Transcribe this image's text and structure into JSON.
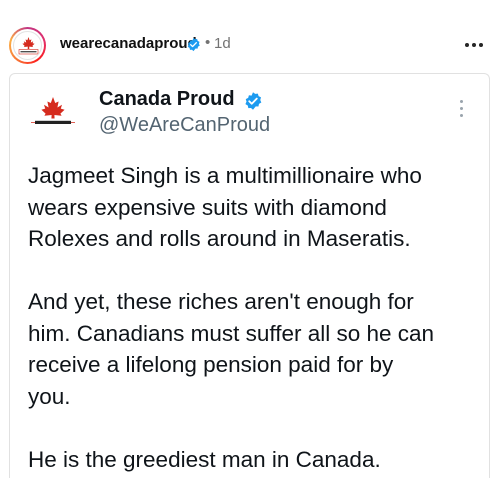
{
  "post": {
    "username": "wearecanadaproud",
    "separator": "•",
    "timestamp": "1d",
    "avatar_icon": "canada-proud-logo-icon",
    "avatar_text": "CANADA PROUD"
  },
  "tweet": {
    "display_name": "Canada Proud",
    "handle": "@WeAreCanProud",
    "logo_text": "CANADA PROUD",
    "paragraphs": [
      [
        "Jagmeet Singh is a multimillionaire who",
        "wears expensive suits with diamond",
        "Rolexes and rolls around in Maseratis."
      ],
      [
        "And yet, these riches aren't enough for",
        "him. Canadians must suffer all so he can",
        "receive a lifelong pension paid for by",
        "you."
      ],
      [
        "He is the greediest man in Canada."
      ]
    ]
  },
  "colors": {
    "verified_blue": "#1d9bf0",
    "maple_red": "#d52b1e"
  }
}
